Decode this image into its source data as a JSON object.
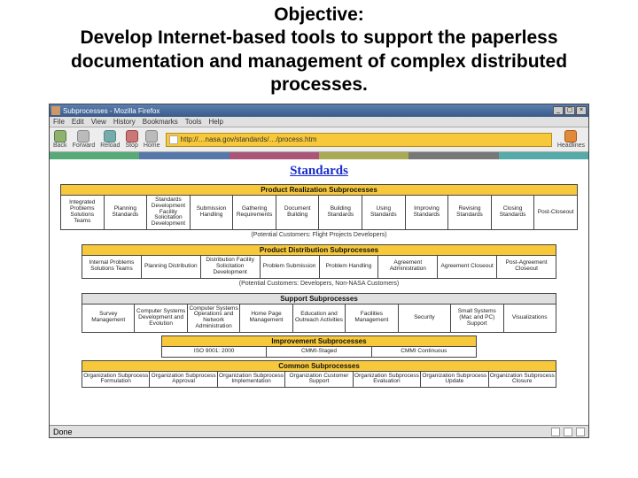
{
  "headline": "Objective:\nDevelop Internet-based tools to support the paperless documentation and management of complex distributed processes.",
  "window": {
    "title": "Subprocesses - Mozilla Firefox",
    "btn_min": "_",
    "btn_max": "▢",
    "btn_close": "×"
  },
  "menu": {
    "file": "File",
    "edit": "Edit",
    "view": "View",
    "history": "History",
    "bookmarks": "Bookmarks",
    "tools": "Tools",
    "help": "Help"
  },
  "nav": {
    "back": "Back",
    "forward": "Forward",
    "reload": "Reload",
    "stop": "Stop",
    "home": "Home"
  },
  "url": "http://…nasa.gov/standards/…/process.htm",
  "rss": {
    "label": "Headlines"
  },
  "page_title": "Standards",
  "sections": {
    "prod_real": {
      "head": "Product Realization Subprocesses",
      "cells": [
        "Integrated Problems Solutions Teams",
        "Planning Standards",
        "Standards Development Facility Solicitation Development",
        "Submission Handling",
        "Gathering Requirements",
        "Document Building",
        "Building Standards",
        "Using Standards",
        "Improving Standards",
        "Revising Standards",
        "Closing Standards",
        "Post-Closeout"
      ],
      "below": "(Potential Customers: Flight Projects Developers)"
    },
    "prod_dist": {
      "head": "Product Distribution Subprocesses",
      "cells": [
        "Internal Problems Solutions Teams",
        "Planning Distribution",
        "Distribution Facility Solicitation Development",
        "Problem Submission",
        "Problem Handling",
        "Agreement Administration",
        "Agreement Closeout",
        "Post-Agreement Closeout"
      ],
      "below": "(Potential Customers: Developers, Non-NASA Customers)"
    },
    "support": {
      "head": "Support Subprocesses",
      "cells": [
        "Survey Management",
        "Computer Systems Development and Evolution",
        "Computer Systems Operations and Network Administration",
        "Home Page Management",
        "Education and Outreach Activities",
        "Facilities Management",
        "Security",
        "Small Systems (Mac and PC) Support",
        "Visualizations"
      ]
    },
    "improve": {
      "head": "Improvement Subprocesses",
      "cells": [
        "ISO 9001: 2000",
        "CMMI-Staged",
        "CMMI Continuous"
      ]
    },
    "common": {
      "head": "Common Subprocesses",
      "cells": [
        "Organization Subprocess Formulation",
        "Organization Subprocess Approval",
        "Organization Subprocess Implementation",
        "Organization Customer Support",
        "Organization Subprocess Evaluation",
        "Organization Subprocess Update",
        "Organization Subprocess Closure"
      ]
    }
  },
  "status": {
    "done": "Done"
  },
  "colors": {
    "accent_yellow": "#f7c93a",
    "link_blue": "#1a2dcc"
  }
}
